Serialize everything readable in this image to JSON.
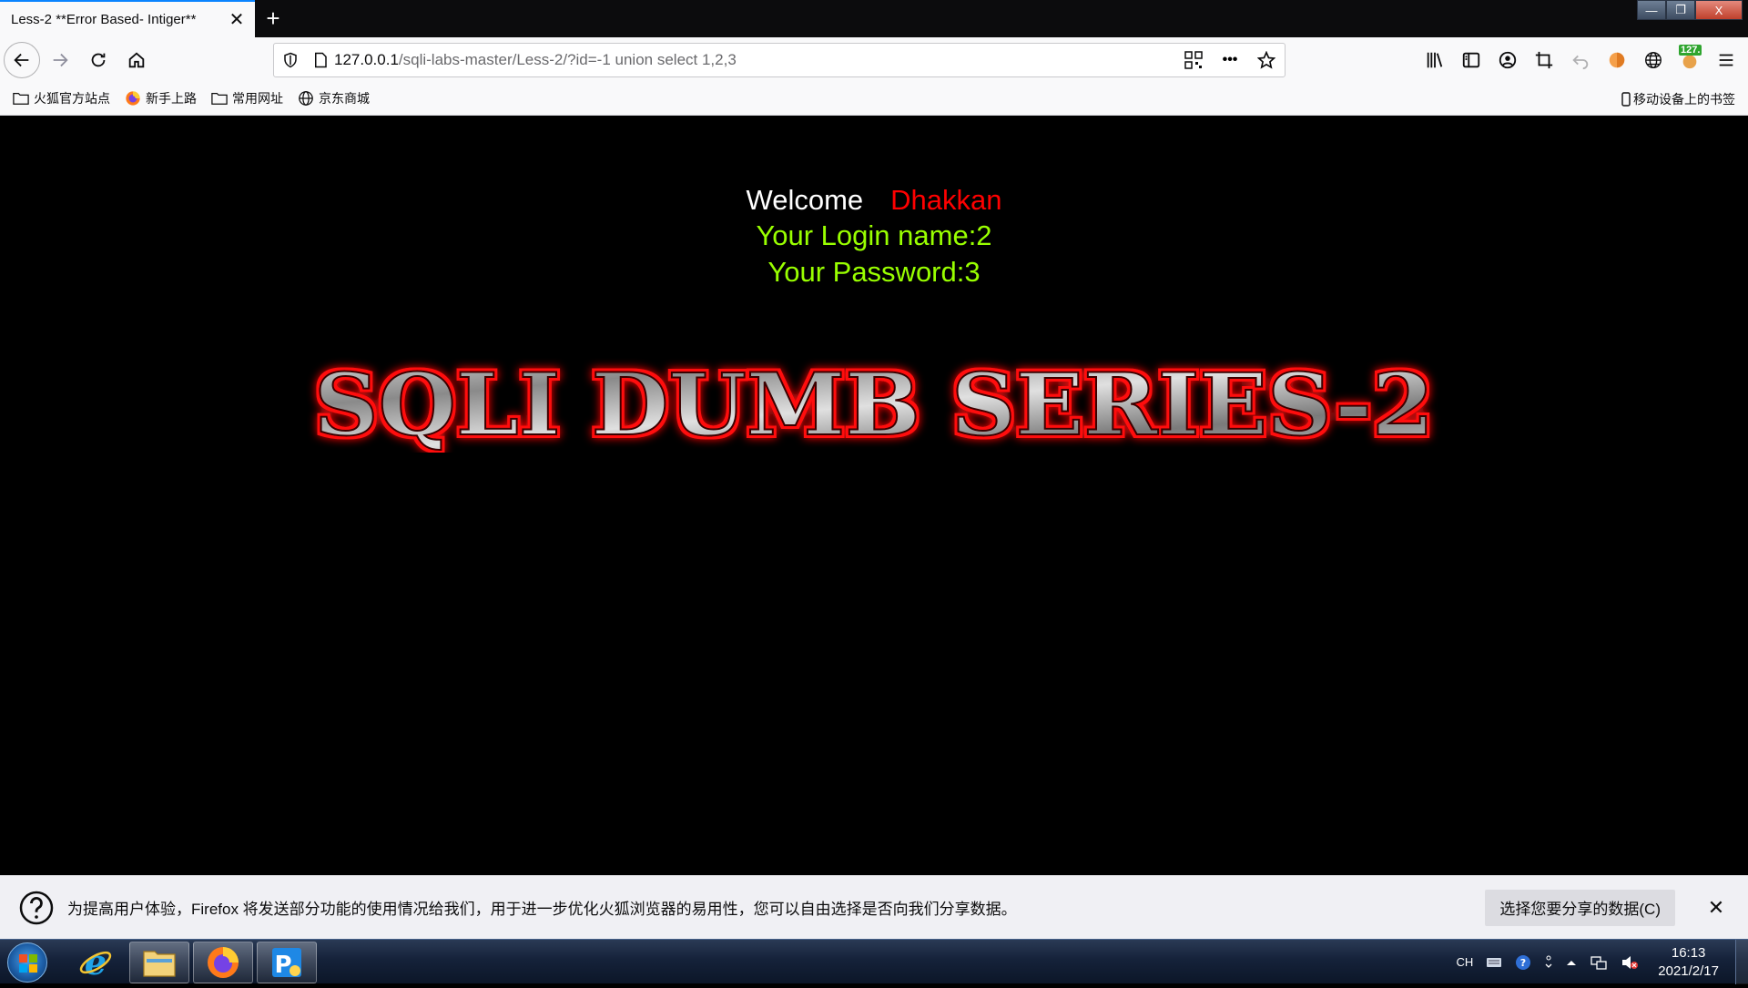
{
  "tab": {
    "title": "Less-2 **Error Based- Intiger**",
    "close": "✕",
    "new_tab": "+"
  },
  "window": {
    "minimize": "—",
    "maximize": "❐",
    "close": "X"
  },
  "url": {
    "host": "127.0.0.1",
    "path": "/sqli-labs-master/Less-2/?id=-1 union select 1,2,3",
    "more": "•••"
  },
  "toolbar": {
    "badge": "127."
  },
  "bookmarks": {
    "items": [
      {
        "label": "火狐官方站点",
        "icon": "folder-icon"
      },
      {
        "label": "新手上路",
        "icon": "firefox-icon"
      },
      {
        "label": "常用网址",
        "icon": "folder-icon"
      },
      {
        "label": "京东商城",
        "icon": "globe-icon"
      }
    ],
    "mobile": "移动设备上的书签"
  },
  "page": {
    "welcome": "Welcome",
    "welcome_name": "Dhakkan",
    "login_name": "Your Login name:2",
    "password": "Your Password:3",
    "banner": "SQLI DUMB SERIES-2"
  },
  "colors": {
    "welcome_name": "#ff0000",
    "credentials": "#99ff00",
    "background": "#000000",
    "accent": "#0a84ff"
  },
  "notification": {
    "text": "为提高用户体验，Firefox 将发送部分功能的使用情况给我们，用于进一步优化火狐浏览器的易用性，您可以自由选择是否向我们分享数据。",
    "button": "选择您要分享的数据(C)",
    "close": "✕"
  },
  "taskbar": {
    "tray_lang": "CH",
    "time": "16:13",
    "date": "2021/2/17"
  }
}
